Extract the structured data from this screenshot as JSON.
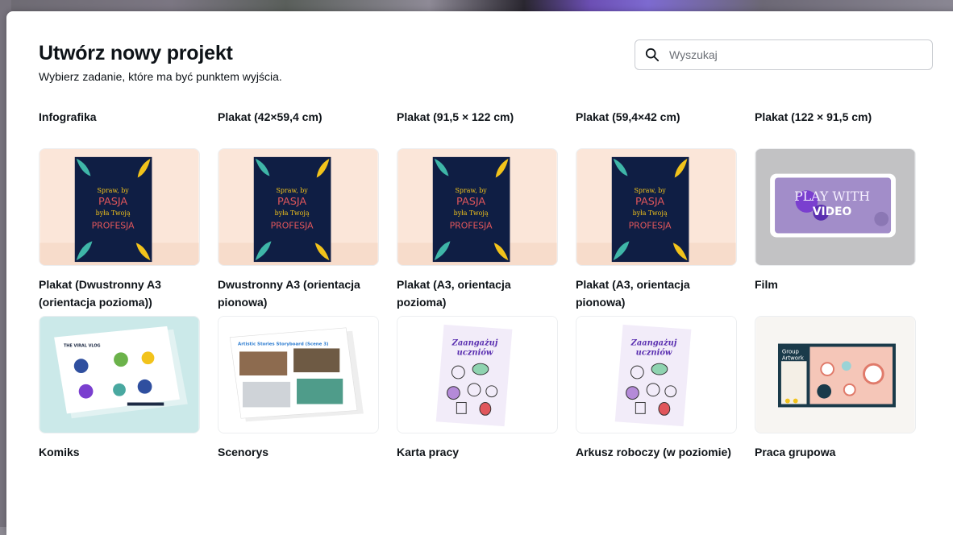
{
  "header": {
    "title": "Utwórz nowy projekt",
    "subtitle": "Wybierz zadanie, które ma być punktem wyjścia."
  },
  "search": {
    "placeholder": "Wyszukaj"
  },
  "top_labels": [
    "Infografika",
    "Plakat (42×59,4 cm)",
    "Plakat (91,5 × 122 cm)",
    "Plakat (59,4×42 cm)",
    "Plakat (122 × 91,5 cm)"
  ],
  "row1": [
    {
      "label": "Plakat (Dwustronny A3 (orientacja pozioma))"
    },
    {
      "label": "Dwustronny A3 (orientacja pionowa)"
    },
    {
      "label": "Plakat (A3, orientacja pozioma)"
    },
    {
      "label": "Plakat (A3, orientacja pionowa)"
    },
    {
      "label": "Film"
    }
  ],
  "row2": [
    {
      "label": "Komiks"
    },
    {
      "label": "Scenorys"
    },
    {
      "label": "Karta pracy"
    },
    {
      "label": "Arkusz roboczy (w poziomie)"
    },
    {
      "label": "Praca grupowa"
    }
  ],
  "thumb_text": {
    "poster_line1": "Spraw, by",
    "poster_line2": "PASJA",
    "poster_line3": "była Twoją",
    "poster_line4": "PROFESJA",
    "video_line1": "PLAY WITH",
    "video_line2": "VIDEO",
    "comic_title": "THE VIRAL VLOG",
    "storyboard_title": "Artistic Stories Storyboard (Scene 3)",
    "worksheet_line1": "Zaangażuj",
    "worksheet_line2": "uczniów",
    "group_title1": "Group",
    "group_title2": "Artwork"
  },
  "colors": {
    "poster_bg": "#fbe6d9",
    "poster_navy": "#0f1e44",
    "film_bg": "#c2c2c4",
    "comic_bg": "#cbe9e9",
    "accent_purple": "#5a2fb0"
  }
}
